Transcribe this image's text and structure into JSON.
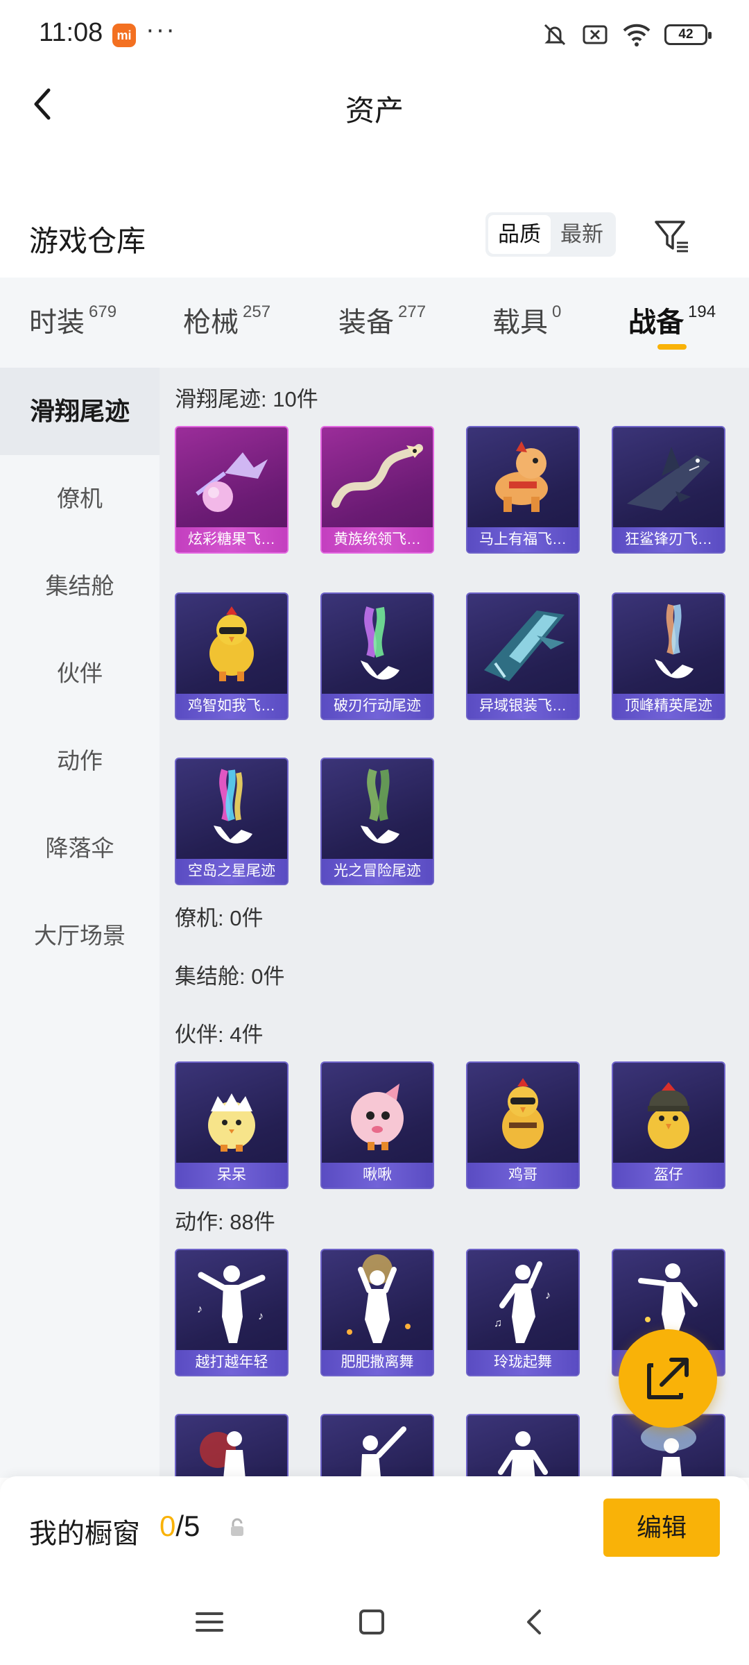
{
  "status_bar": {
    "time": "11:08",
    "mi_badge": "mi",
    "more": "···",
    "battery": "42"
  },
  "header": {
    "title": "资产"
  },
  "warehouse": {
    "title": "游戏仓库",
    "sort_options": [
      "品质",
      "最新"
    ]
  },
  "tabs": [
    {
      "label": "时装",
      "count": "679"
    },
    {
      "label": "枪械",
      "count": "257"
    },
    {
      "label": "装备",
      "count": "277"
    },
    {
      "label": "载具",
      "count": "0"
    },
    {
      "label": "战备",
      "count": "194"
    }
  ],
  "sidebar": {
    "items": [
      {
        "label": "滑翔尾迹"
      },
      {
        "label": "僚机"
      },
      {
        "label": "集结舱"
      },
      {
        "label": "伙伴"
      },
      {
        "label": "动作"
      },
      {
        "label": "降落伞"
      },
      {
        "label": "大厅场景"
      }
    ]
  },
  "sections": {
    "trails": {
      "header": "滑翔尾迹: 10件",
      "items": [
        "炫彩糖果飞…",
        "黄族统领飞…",
        "马上有福飞…",
        "狂鲨锋刃飞…",
        "鸡智如我飞…",
        "破刃行动尾迹",
        "异域银装飞…",
        "顶峰精英尾迹",
        "空岛之星尾迹",
        "光之冒险尾迹"
      ]
    },
    "wingman": {
      "header": "僚机: 0件"
    },
    "pod": {
      "header": "集结舱: 0件"
    },
    "partners": {
      "header": "伙伴: 4件",
      "items": [
        "呆呆",
        "啾啾",
        "鸡哥",
        "盔仔"
      ]
    },
    "emotes": {
      "header": "动作: 88件",
      "items": [
        "越打越年轻",
        "肥肥撒离舞",
        "玲珑起舞",
        ""
      ]
    }
  },
  "bottom_bar": {
    "title": "我的橱窗",
    "count_current": "0",
    "count_total": "/5",
    "edit_label": "编辑"
  },
  "colors": {
    "accent": "#f9b208",
    "card_purple": "#2e2865",
    "card_pink": "#8a2488"
  }
}
